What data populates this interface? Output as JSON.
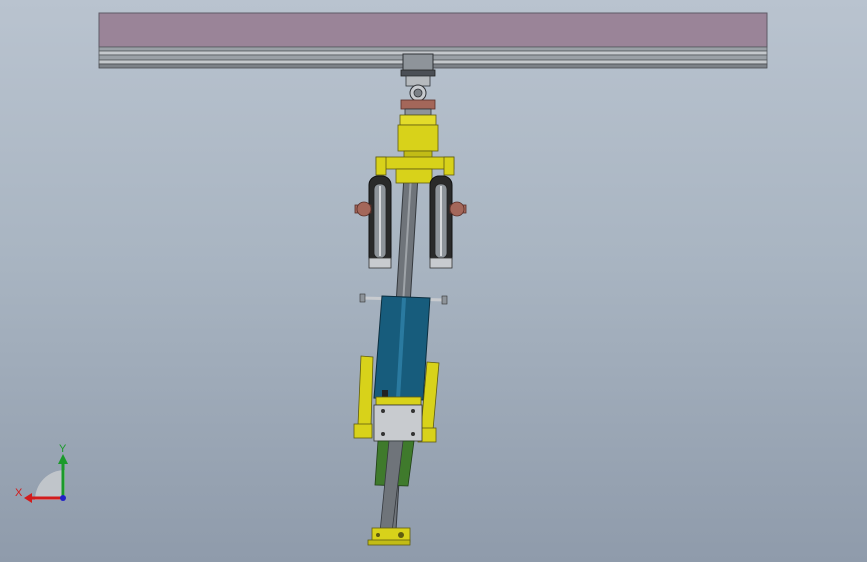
{
  "viewport": {
    "background_top": "#b9c3cf",
    "background_bottom": "#8f9bab"
  },
  "model": {
    "rail_color": "#9a8498",
    "rail_trim_color": "#5c5f64",
    "shaft_color": "#6f747a",
    "yellow_part_color": "#d8d21a",
    "motor_color": "#175c7c",
    "green_part_color": "#3f7a2c",
    "wheel_color": "#2a2a2a",
    "brake_color": "#a4675a"
  },
  "triad": {
    "x_label": "X",
    "y_label": "Y",
    "x_color": "#d21c1c",
    "y_color": "#1a9a2a",
    "z_color": "#2020c8"
  }
}
